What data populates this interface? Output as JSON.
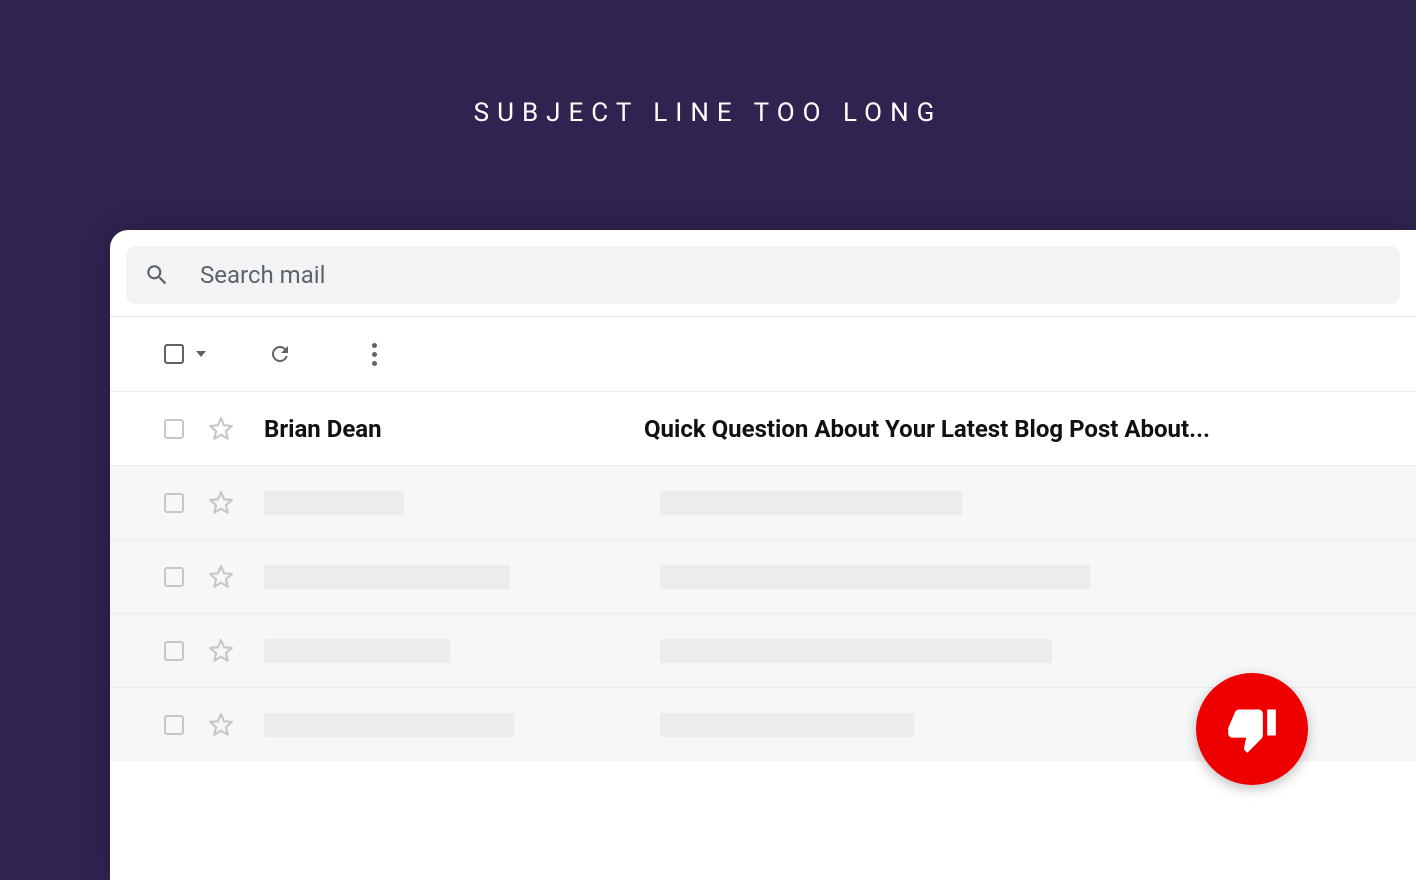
{
  "heading": "SUBJECT LINE TOO LONG",
  "search": {
    "placeholder": "Search mail"
  },
  "messages": [
    {
      "sender": "Brian Dean",
      "subject": "Quick Question About Your Latest Blog Post About...",
      "unread": true,
      "placeholder": false
    }
  ],
  "placeholder_rows": [
    {
      "sender_w": 140,
      "subject_w": 302
    },
    {
      "sender_w": 246,
      "subject_w": 430
    },
    {
      "sender_w": 186,
      "subject_w": 392
    },
    {
      "sender_w": 250,
      "subject_w": 254
    }
  ],
  "badge": {
    "verdict": "negative"
  }
}
